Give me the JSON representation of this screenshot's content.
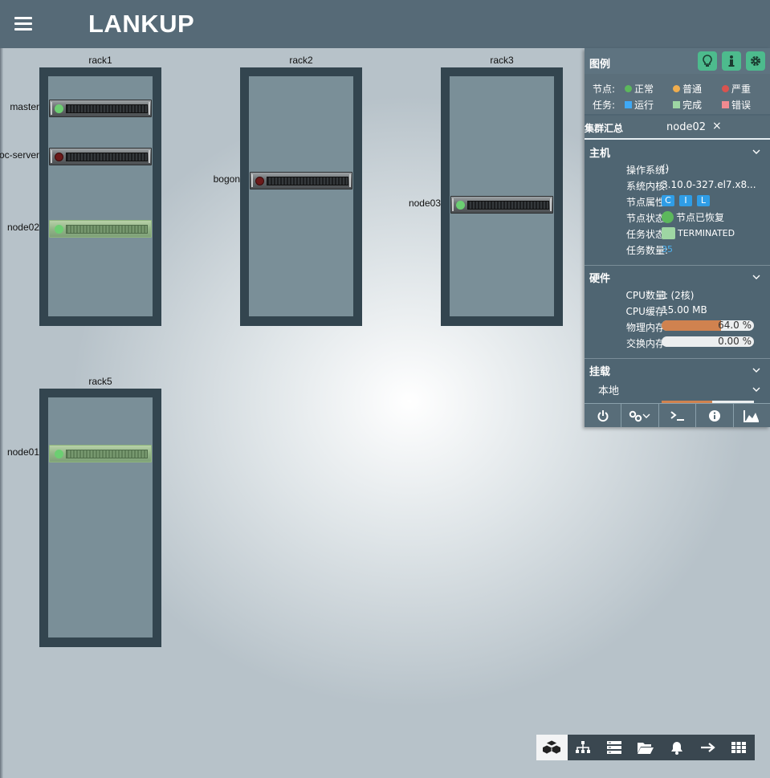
{
  "app": {
    "title": "LANKUP"
  },
  "racks": [
    {
      "name": "rack1",
      "nodes": [
        {
          "label": "master",
          "status": "green"
        },
        {
          "label": "oc-server",
          "status": "red"
        },
        {
          "label": "node02",
          "status": "green",
          "selected": true
        }
      ]
    },
    {
      "name": "rack2",
      "nodes": [
        {
          "label": "bogon",
          "status": "red"
        }
      ]
    },
    {
      "name": "rack3",
      "nodes": [
        {
          "label": "node03",
          "status": "green"
        }
      ]
    },
    {
      "name": "rack5",
      "nodes": [
        {
          "label": "node01",
          "status": "green",
          "selected": true
        }
      ]
    }
  ],
  "panel": {
    "legend": {
      "title": "图例",
      "node_key": "节点:",
      "task_key": "任务:",
      "node_items": [
        {
          "label": "正常",
          "color": "#5cb85c"
        },
        {
          "label": "普通",
          "color": "#f0ad4e"
        },
        {
          "label": "严重",
          "color": "#d9534f"
        }
      ],
      "task_items": [
        {
          "label": "运行",
          "color": "#3fa9f5"
        },
        {
          "label": "完成",
          "color": "#9ed6a3"
        },
        {
          "label": "错误",
          "color": "#f08a90"
        }
      ],
      "buttons": [
        "lightbulb-icon",
        "info-icon",
        "gear-icon"
      ]
    },
    "tabs": {
      "summary": "集群汇总",
      "node": "node02",
      "close": "×"
    },
    "host": {
      "title": "主机",
      "os_key": "操作系统:",
      "os_val": "()",
      "kernel_key": "系统内核:",
      "kernel_val": "3.10.0-327.el7.x8...",
      "attr_key": "节点属性:",
      "attrs": [
        "C",
        "I",
        "L"
      ],
      "node_status_key": "节点状态:",
      "node_status_val": "节点已恢复",
      "task_status_key": "任务状态:",
      "task_status_val": "TERMINATED",
      "task_count_key": "任务数量:",
      "task_count_val": "35"
    },
    "hardware": {
      "title": "硬件",
      "cpu_count_key": "CPU数量:",
      "cpu_count_val": "1 (2核)",
      "cpu_cache_key": "CPU缓存:",
      "cpu_cache_val": "15.00 MB",
      "mem_key": "物理内存:",
      "mem_val": "64.0 %",
      "mem_fraction": 0.64,
      "swap_key": "交换内存:",
      "swap_val": "0.00 %",
      "swap_fraction": 0.0
    },
    "mount": {
      "title": "挂载",
      "local": "本地"
    },
    "toolbar": [
      "power-icon",
      "link-icon",
      "terminal-icon",
      "info-icon",
      "chart-icon"
    ]
  },
  "dock": [
    "topology-icon",
    "hierarchy-icon",
    "server-list-icon",
    "folder-icon",
    "bell-icon",
    "arrow-right-icon",
    "grid-icon"
  ]
}
